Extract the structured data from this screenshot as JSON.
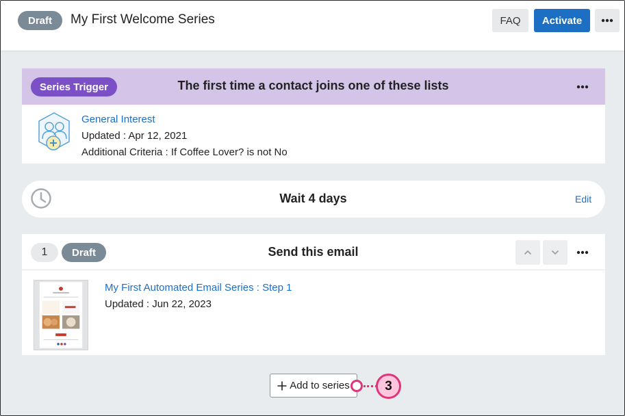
{
  "header": {
    "status": "Draft",
    "title": "My First Welcome Series",
    "faq_label": "FAQ",
    "activate_label": "Activate",
    "more_icon": "ellipsis-icon"
  },
  "trigger": {
    "badge": "Series Trigger",
    "heading": "The first time a contact joins one of these lists",
    "list": {
      "name": "General Interest",
      "updated": "Updated : Apr 12, 2021",
      "criteria": "Additional Criteria : If Coffee Lover? is not No"
    }
  },
  "wait": {
    "label": "Wait 4 days",
    "edit_label": "Edit"
  },
  "email_step": {
    "number": "1",
    "status": "Draft",
    "heading": "Send this email",
    "email_name": "My First Automated Email Series : Step 1",
    "updated": "Updated : Jun 22, 2023"
  },
  "add_button": {
    "label": "Add to series"
  },
  "callout": {
    "number": "3"
  },
  "colors": {
    "primary": "#1d6fc4",
    "trigger_bg": "#d3c4e8",
    "trigger_pill": "#7b4fc6",
    "draft_pill": "#7b8a97",
    "callout": "#e0347c"
  }
}
